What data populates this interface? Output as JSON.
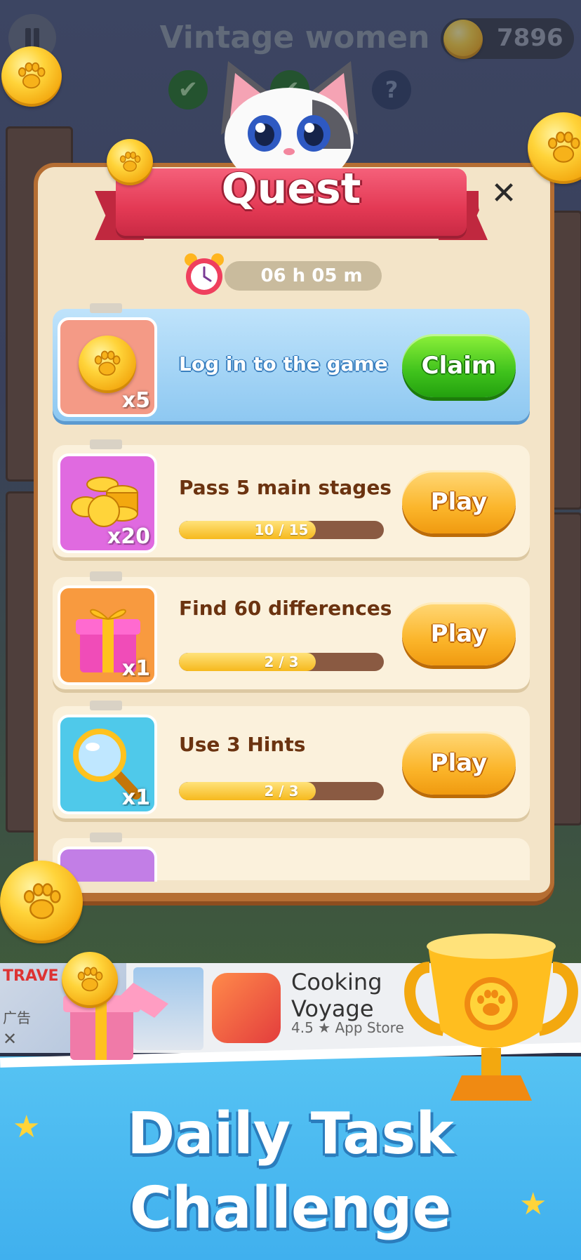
{
  "header": {
    "stage_title": "Vintage women",
    "coin_count": "7896",
    "help_symbol": "?",
    "pause_icon": "pause-icon",
    "check_icon": "check-icon"
  },
  "quest": {
    "title": "Quest",
    "close_label": "✕",
    "timer": "06 h 05 m"
  },
  "tasks": [
    {
      "title": "Log in to the game",
      "reward_icon": "paw-coin",
      "reward_multiplier": "x5",
      "button_label": "Claim",
      "highlighted": true,
      "icon_bg": "#f49a86"
    },
    {
      "title": "Pass 5 main stages",
      "reward_icon": "coin-pile",
      "reward_multiplier": "x20",
      "progress_text": "10 / 15",
      "progress_fraction": 0.6667,
      "button_label": "Play",
      "icon_bg": "#e06ae0"
    },
    {
      "title": "Find 60 differences",
      "reward_icon": "gift-box",
      "reward_multiplier": "x1",
      "progress_text": "2 / 3",
      "progress_fraction": 0.6667,
      "button_label": "Play",
      "icon_bg": "#f89a3f"
    },
    {
      "title": "Use 3 Hints",
      "reward_icon": "magnifier",
      "reward_multiplier": "x1",
      "progress_text": "2 / 3",
      "progress_fraction": 0.6667,
      "button_label": "Play",
      "icon_bg": "#4fc9ea"
    }
  ],
  "ad": {
    "left_brand": "TRAVE",
    "left_tag": "广告",
    "close_symbol": "✕",
    "app_name_line1": "Cooking",
    "app_name_line2": "Voyage",
    "rating": "4.5 ★ App Store"
  },
  "promo": {
    "line1": "Daily Task",
    "line2": "Challenge"
  },
  "colors": {
    "modal_bg": "#f3e4c8",
    "modal_border": "#b56e33",
    "ribbon": "#e33954",
    "claim_green": "#3fc21c",
    "play_orange": "#fbb52a",
    "promo_blue": "#4ab8ef"
  }
}
